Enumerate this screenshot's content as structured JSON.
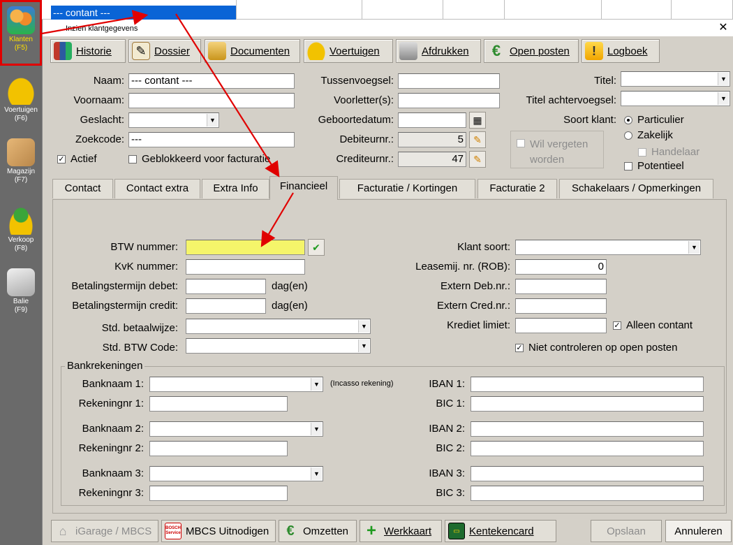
{
  "sidebar": {
    "items": [
      {
        "label": "Klanten",
        "key": "(F5)",
        "icon": "customers-icon",
        "selected": true
      },
      {
        "label": "Voertuigen",
        "key": "(F6)",
        "icon": "car-icon"
      },
      {
        "label": "Magazijn",
        "key": "(F7)",
        "icon": "box-icon"
      },
      {
        "label": "Verkoop",
        "key": "(F8)",
        "icon": "euro-car-icon"
      },
      {
        "label": "Balie",
        "key": "(F9)",
        "icon": "cash-register-icon"
      }
    ]
  },
  "grid": {
    "selected_row": "--- contant ---"
  },
  "dialog": {
    "title": "Inzien klantgegevens",
    "close": "✕",
    "toolbar": {
      "historie": "Historie",
      "dossier": "Dossier",
      "documenten": "Documenten",
      "voertuigen": "Voertuigen",
      "afdrukken": "Afdrukken",
      "open_posten": "Open posten",
      "logboek": "Logboek"
    },
    "fields": {
      "naam_label": "Naam:",
      "naam_value": "--- contant ---",
      "voornaam_label": "Voornaam:",
      "voornaam_value": "",
      "geslacht_label": "Geslacht:",
      "geslacht_value": "",
      "zoekcode_label": "Zoekcode:",
      "zoekcode_value": "---",
      "actief_label": "Actief",
      "actief_checked": true,
      "geblokkeerd_label": "Geblokkeerd voor facturatie",
      "geblokkeerd_checked": false,
      "tussenvoegsel_label": "Tussenvoegsel:",
      "tussenvoegsel_value": "",
      "voorletters_label": "Voorletter(s):",
      "voorletters_value": "",
      "geboortedatum_label": "Geboortedatum:",
      "geboortedatum_value": "",
      "debiteurnr_label": "Debiteurnr.:",
      "debiteurnr_value": "5",
      "crediteurnr_label": "Crediteurnr.:",
      "crediteurnr_value": "47",
      "wil_vergeten_label": "Wil vergeten worden",
      "titel_label": "Titel:",
      "titel_value": "",
      "titel_achter_label": "Titel achtervoegsel:",
      "titel_achter_value": "",
      "soort_klant_label": "Soort klant:",
      "particulier_label": "Particulier",
      "particulier_selected": true,
      "zakelijk_label": "Zakelijk",
      "zakelijk_selected": false,
      "handelaar_label": "Handelaar",
      "potentieel_label": "Potentieel",
      "potentieel_checked": false
    },
    "tabs": [
      "Contact",
      "Contact extra",
      "Extra Info",
      "Financieel",
      "Facturatie / Kortingen",
      "Facturatie 2",
      "Schakelaars / Opmerkingen"
    ],
    "active_tab": "Financieel",
    "financieel": {
      "btw_label": "BTW nummer:",
      "btw_value": "",
      "kvk_label": "KvK nummer:",
      "kvk_value": "",
      "bt_debet_label": "Betalingstermijn debet:",
      "bt_debet_value": "",
      "bt_debet_unit": "dag(en)",
      "bt_credit_label": "Betalingstermijn credit:",
      "bt_credit_value": "",
      "bt_credit_unit": "dag(en)",
      "betaalwijze_label": "Std. betaalwijze:",
      "betaalwijze_value": "",
      "btwcode_label": "Std. BTW Code:",
      "btwcode_value": "",
      "klant_soort_label": "Klant soort:",
      "klant_soort_value": "",
      "leasemij_label": "Leasemij. nr. (ROB):",
      "leasemij_value": "0",
      "extern_deb_label": "Extern Deb.nr.:",
      "extern_deb_value": "",
      "extern_cred_label": "Extern Cred.nr.:",
      "extern_cred_value": "",
      "krediet_label": "Krediet limiet:",
      "krediet_value": "",
      "alleen_contant_label": "Alleen contant",
      "alleen_contant_checked": true,
      "niet_controleren_label": "Niet controleren op open posten",
      "niet_controleren_checked": true
    },
    "bank": {
      "group_label": "Bankrekeningen",
      "incasso_note": "(Incasso rekening)",
      "rows": [
        {
          "banknaam_label": "Banknaam 1:",
          "rekeningnr_label": "Rekeningnr 1:",
          "iban_label": "IBAN 1:",
          "bic_label": "BIC 1:"
        },
        {
          "banknaam_label": "Banknaam 2:",
          "rekeningnr_label": "Rekeningnr 2:",
          "iban_label": "IBAN 2:",
          "bic_label": "BIC 2:"
        },
        {
          "banknaam_label": "Banknaam 3:",
          "rekeningnr_label": "Rekeningnr 3:",
          "iban_label": "IBAN 3:",
          "bic_label": "BIC 3:"
        }
      ]
    },
    "bottom": {
      "igarage": "iGarage / MBCS",
      "bosch_logo_text": "BOSCH Service",
      "mbcs_uitnodigen": "MBCS Uitnodigen",
      "omzetten": "Omzetten",
      "werkkaart": "Werkkaart",
      "kentekencard": "Kentekencard",
      "opslaan": "Opslaan",
      "annuleren": "Annuleren"
    }
  },
  "colors": {
    "accent_red": "#e00000",
    "selection_blue": "#0a64d6",
    "highlight_yellow": "#f5f56a",
    "sidebar_bg": "#6a6a6a"
  }
}
